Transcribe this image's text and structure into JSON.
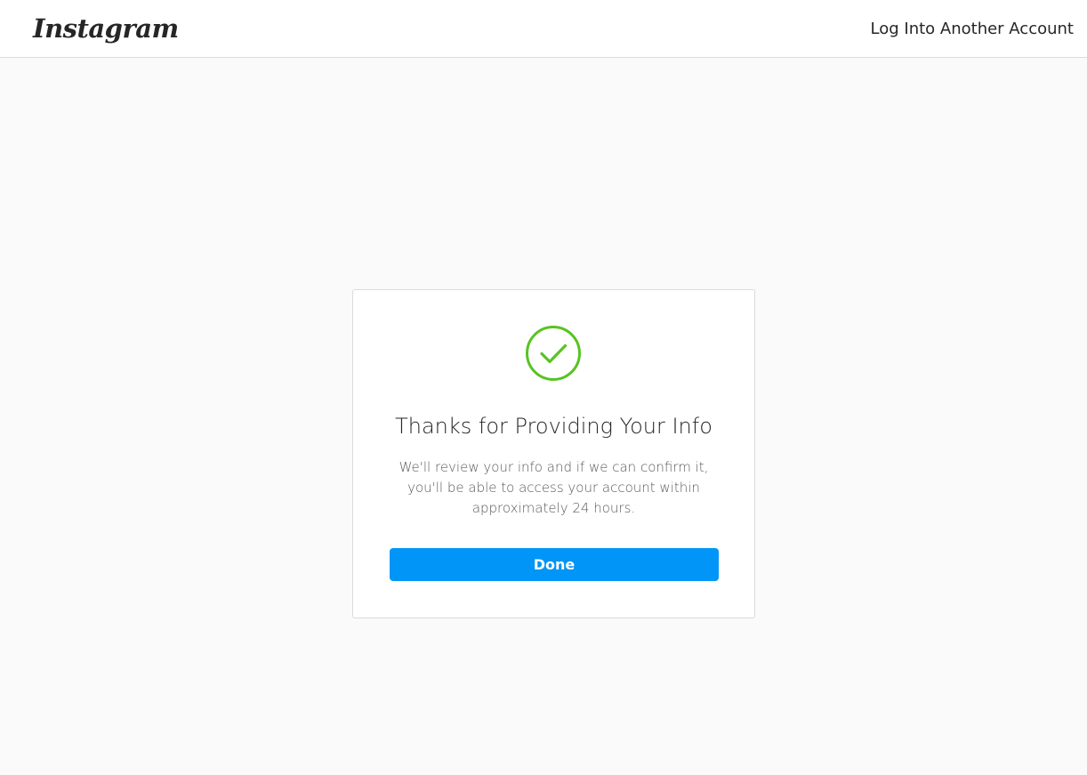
{
  "header": {
    "logo_text": "Instagram",
    "another_account_link": "Log Into Another Account"
  },
  "confirmation": {
    "icon": "check-circle-icon",
    "title": "Thanks for Providing Your Info",
    "body": "We'll review your info and if we can confirm it, you'll be able to access your account within approximately 24 hours.",
    "done_button": "Done"
  },
  "colors": {
    "accent_blue": "#0095f6",
    "success_green": "#58c322",
    "page_background": "#fafafa",
    "border": "#dbdbdb"
  }
}
